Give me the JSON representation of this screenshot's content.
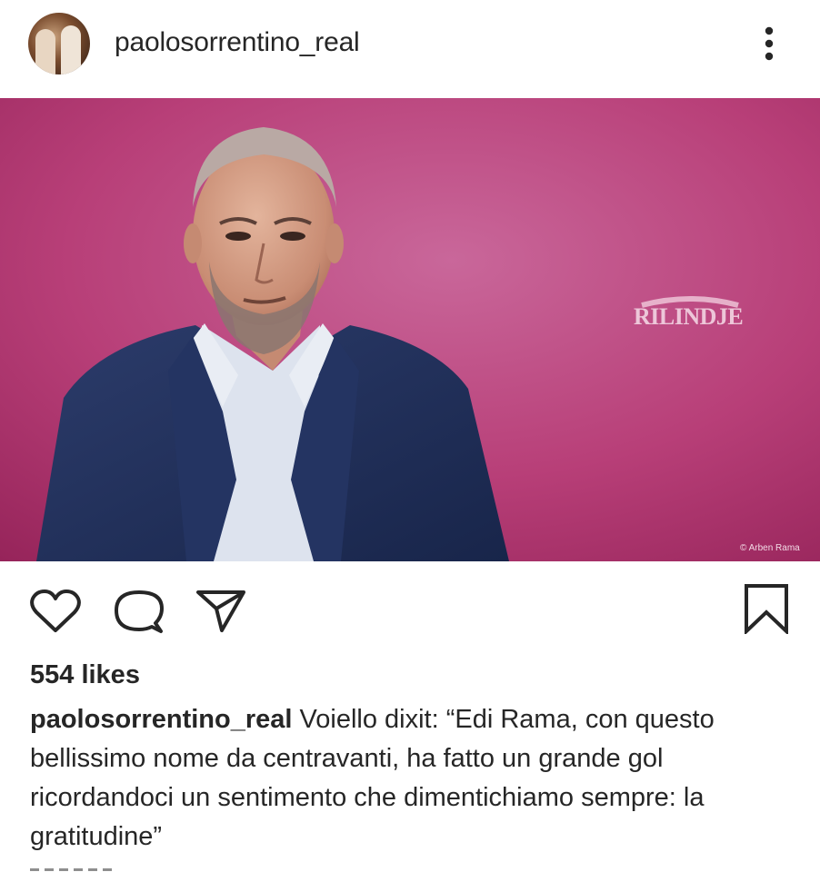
{
  "post": {
    "username": "paolosorrentino_real",
    "image": {
      "alt": "",
      "watermark_text": "RILINDJE",
      "credit_text": "© Arben Rama"
    },
    "likes_text": "554 likes",
    "caption_user": "paolosorrentino_real",
    "caption_text": " Voiello dixit: “Edi Rama, con questo bellissimo nome da centravanti, ha fatto un grande gol ricordandoci un sentimento che dimentichiamo sempre: la gratitudine”"
  },
  "icons": {
    "more": "more-vertical-icon",
    "like": "heart-icon",
    "comment": "comment-icon",
    "share": "send-icon",
    "save": "bookmark-icon"
  },
  "colors": {
    "text": "#262626",
    "photo_background": "#b8346f",
    "jacket": "#1f2d55"
  }
}
